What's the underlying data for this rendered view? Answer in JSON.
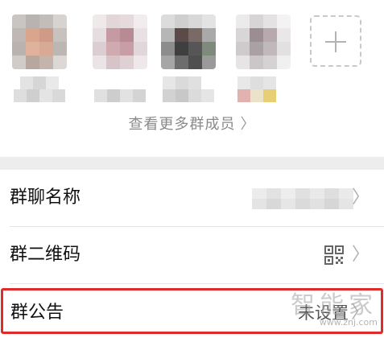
{
  "members": {
    "items": [
      {
        "name": "member-1"
      },
      {
        "name": "member-2"
      },
      {
        "name": "member-3"
      },
      {
        "name": "member-4"
      }
    ],
    "view_more_label": "查看更多群成员",
    "view_more_chevron": "〉"
  },
  "settings": {
    "group_name_label": "群聊名称",
    "qr_code_label": "群二维码",
    "notice_label": "群公告",
    "notice_value": "未设置",
    "chevron": "〉"
  },
  "watermark": {
    "text": "智能家",
    "url": "www.znj.com"
  }
}
